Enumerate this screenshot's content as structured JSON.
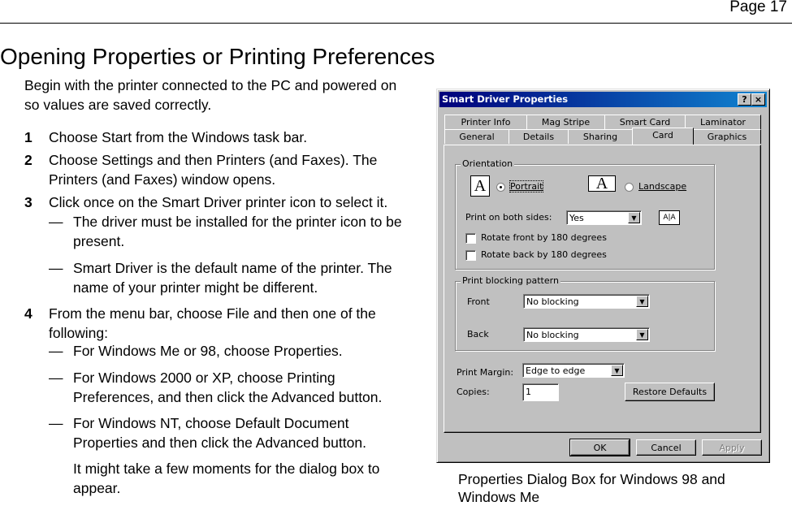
{
  "page_number": "Page 17",
  "heading": "Opening Properties or Printing Preferences",
  "intro": "Begin with the printer connected to the PC and powered on so values are saved correctly.",
  "steps": [
    {
      "num": "1",
      "text": "Choose Start from the Windows task bar."
    },
    {
      "num": "2",
      "text": "Choose Settings and then Printers (and Faxes). The Printers (and Faxes) window opens."
    },
    {
      "num": "3",
      "text": "Click once on the Smart Driver printer icon to select it."
    },
    {
      "num": "4",
      "text": "From the menu bar, choose File and then one of the following:"
    }
  ],
  "step3_notes": [
    "The driver must be installed for the printer icon to be present.",
    "Smart Driver is the default name of the printer. The name of your printer might be different."
  ],
  "step4_options": [
    "For Windows Me or 98, choose Properties.",
    "For Windows 2000 or XP, choose Printing Preferences, and then click the Advanced button.",
    "For Windows NT, choose Default Document Properties and then click the Advanced button."
  ],
  "dash": "—",
  "wait_note": "It might take a few moments for the dialog box to appear.",
  "caption": "Properties Dialog Box for Windows 98 and Windows Me",
  "dialog": {
    "title": "Smart Driver Properties",
    "help_btn": "?",
    "close_btn": "×",
    "tabs_back": [
      "Printer Info",
      "Mag Stripe",
      "Smart Card",
      "Laminator"
    ],
    "tabs_front": [
      "General",
      "Details",
      "Sharing",
      "Card",
      "Graphics"
    ],
    "orientation": {
      "legend": "Orientation",
      "big_letter": "A",
      "portrait": "Portrait",
      "landscape": "Landscape",
      "selected": "Portrait"
    },
    "print_both_sides_label": "Print on both sides:",
    "print_both_sides_value": "Yes",
    "duplex_icon": "A|A",
    "rotate_front": "Rotate front by 180 degrees",
    "rotate_back": "Rotate back by 180 degrees",
    "blocking": {
      "legend": "Print blocking pattern",
      "front_label": "Front",
      "front_value": "No blocking",
      "back_label": "Back",
      "back_value": "No blocking"
    },
    "print_margin_label": "Print Margin:",
    "print_margin_value": "Edge to edge",
    "copies_label": "Copies:",
    "copies_value": "1",
    "restore_defaults": "Restore Defaults",
    "ok": "OK",
    "cancel": "Cancel",
    "apply": "Apply",
    "dropdown_arrow": "▼"
  }
}
